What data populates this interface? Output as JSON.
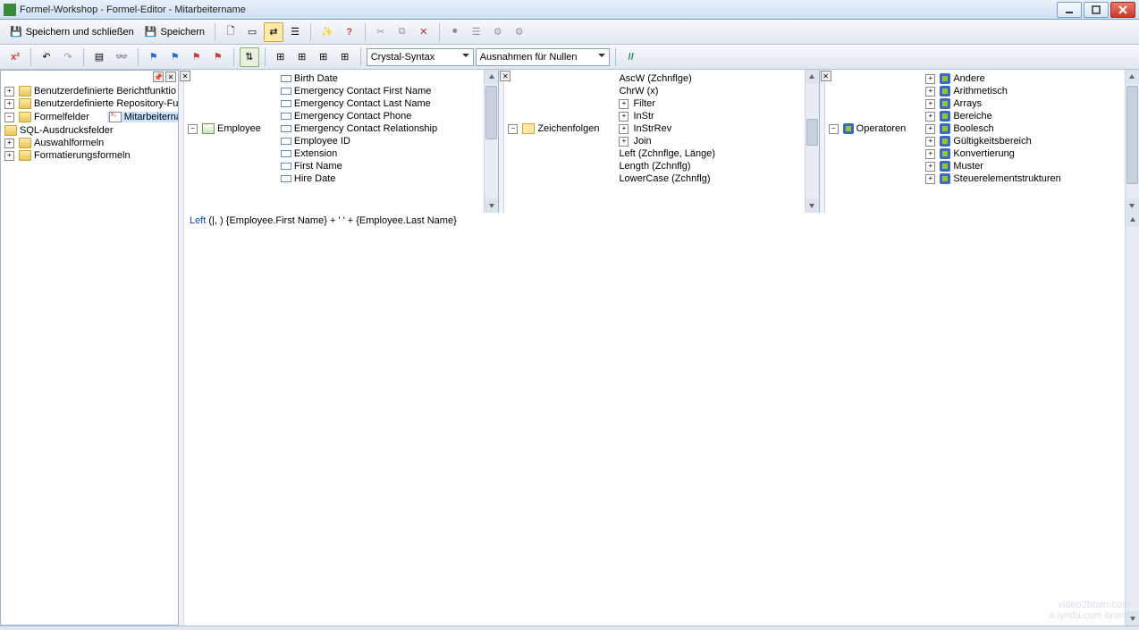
{
  "window": {
    "title": "Formel-Workshop - Formel-Editor - Mitarbeitername"
  },
  "toolbar1": {
    "save_close": "Speichern und schließen",
    "save": "Speichern"
  },
  "toolbar2": {
    "syntax": "Crystal-Syntax",
    "nulls": "Ausnahmen für Nullen"
  },
  "left_tree": {
    "items": [
      {
        "icon": "folder",
        "label": "Benutzerdefinierte Berichtfunktio",
        "kind": "collapsed"
      },
      {
        "icon": "folder",
        "label": "Benutzerdefinierte Repository-Fu",
        "kind": "collapsed"
      },
      {
        "icon": "folder",
        "label": "Formelfelder",
        "kind": "expanded",
        "children": [
          {
            "icon": "formula",
            "label": "Mitarbeitername",
            "selected": true
          }
        ]
      },
      {
        "icon": "folder",
        "label": "SQL-Ausdrucksfelder",
        "kind": "leaf"
      },
      {
        "icon": "folder",
        "label": "Auswahlformeln",
        "kind": "collapsed"
      },
      {
        "icon": "folder",
        "label": "Formatierungsformeln",
        "kind": "collapsed"
      }
    ]
  },
  "fields_tree": {
    "table": "Employee",
    "fields": [
      "Birth Date",
      "Emergency Contact First Name",
      "Emergency Contact Last Name",
      "Emergency Contact Phone",
      "Emergency Contact Relationship",
      "Employee ID",
      "Extension",
      "First Name",
      "Hire Date"
    ]
  },
  "functions_tree": {
    "category": "Zeichenfolgen",
    "items": [
      {
        "label": "AscW (Zchnflge)",
        "expandable": false
      },
      {
        "label": "ChrW (x)",
        "expandable": false
      },
      {
        "label": "Filter",
        "expandable": true
      },
      {
        "label": "InStr",
        "expandable": true
      },
      {
        "label": "InStrRev",
        "expandable": true
      },
      {
        "label": "Join",
        "expandable": true
      },
      {
        "label": "Left (Zchnflge, Länge)",
        "expandable": false
      },
      {
        "label": "Length (Zchnflg)",
        "expandable": false
      },
      {
        "label": "LowerCase (Zchnflg)",
        "expandable": false
      }
    ]
  },
  "operators_tree": {
    "root": "Operatoren",
    "cats": [
      "Andere",
      "Arithmetisch",
      "Arrays",
      "Bereiche",
      "Boolesch",
      "Gültigkeitsbereich",
      "Konvertierung",
      "Muster",
      "Steuerelementstrukturen"
    ]
  },
  "editor": {
    "tokens": [
      {
        "t": "kw",
        "v": "Left"
      },
      {
        "t": "",
        "v": " (|, ) "
      },
      {
        "t": "field",
        "v": "{Employee.First Name}"
      },
      {
        "t": "",
        "v": " + "
      },
      {
        "t": "str",
        "v": "' '"
      },
      {
        "t": "",
        "v": " + "
      },
      {
        "t": "field",
        "v": "{Employee.Last Name}"
      }
    ],
    "raw": "Left (|, ) {Employee.First Name} + ' ' + {Employee.Last Name}"
  },
  "watermark": {
    "line1": "video2brain.com",
    "line2": "a lynda.com brand"
  }
}
